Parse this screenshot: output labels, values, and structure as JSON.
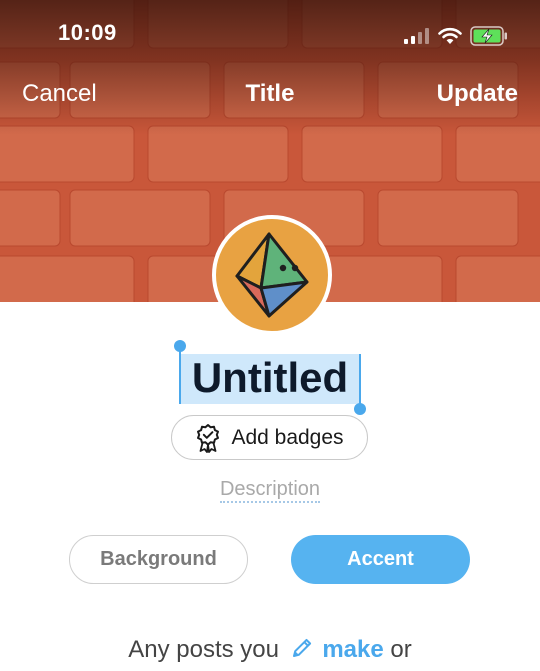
{
  "status_bar": {
    "time": "10:09",
    "icons": [
      "cellular-signal-icon",
      "wifi-icon",
      "battery-charging-icon"
    ]
  },
  "nav": {
    "cancel_label": "Cancel",
    "title": "Title",
    "update_label": "Update"
  },
  "profile": {
    "avatar_icon": "octahedron-avatar-icon",
    "name": "Untitled",
    "add_badges_label": "Add badges",
    "description_placeholder": "Description"
  },
  "colors": {
    "header_brick": "#c9573a",
    "accent": "#56b3f0",
    "text_selection": "#cfe8fb"
  },
  "buttons": {
    "background_label": "Background",
    "accent_label": "Accent"
  },
  "posts_text": {
    "before": "Any posts you",
    "link": "make",
    "after": "or"
  }
}
